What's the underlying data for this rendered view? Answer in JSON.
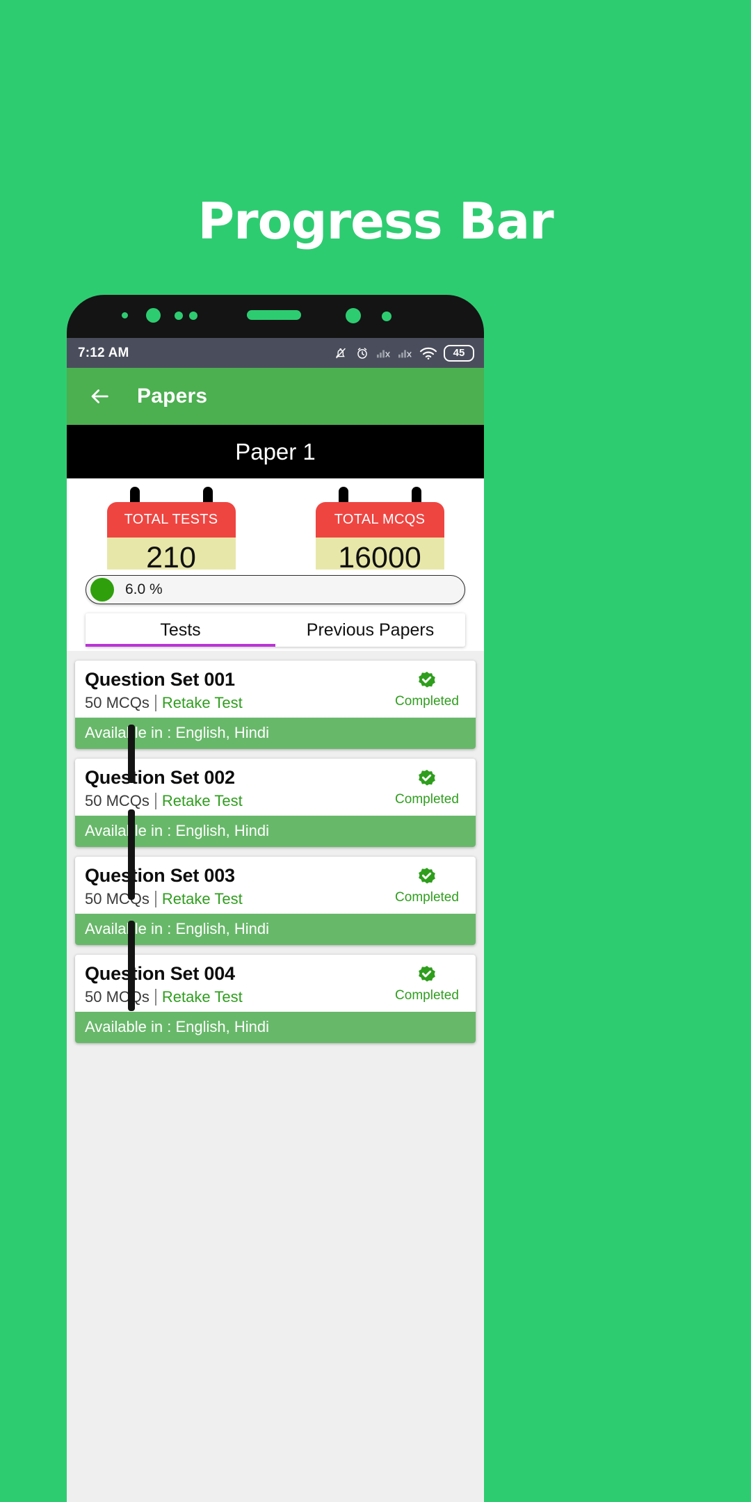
{
  "promo": {
    "title": "Progress Bar",
    "bg_color": "#2ECC71"
  },
  "statusbar": {
    "time": "7:12 AM",
    "battery": "45",
    "icons": [
      "bell-muted-icon",
      "alarm-icon",
      "signal-1-icon",
      "signal-2-icon",
      "wifi-icon",
      "battery-icon"
    ],
    "bg_color": "#4A4E5C"
  },
  "appbar": {
    "title": "Papers",
    "back_icon": "back-arrow-icon",
    "bg_color": "#4CAF50"
  },
  "banner": {
    "title": "Paper 1",
    "bg_color": "#000000"
  },
  "stats": [
    {
      "label": "TOTAL TESTS",
      "value": "210",
      "head_color": "#EF4541",
      "body_color": "#E7E7A9"
    },
    {
      "label": "TOTAL MCQS",
      "value": "16000",
      "head_color": "#EF4541",
      "body_color": "#E7E7A9"
    }
  ],
  "progress": {
    "text": "6.0 %",
    "percent": 6.0,
    "knob_color": "#2FA00C"
  },
  "tabs": [
    {
      "label": "Tests",
      "active": true
    },
    {
      "label": "Previous Papers",
      "active": false
    }
  ],
  "tab_indicator_color": "#BA33D6",
  "list": [
    {
      "title": "Question Set 001",
      "mcqs": "50 MCQs",
      "retake": "Retake Test",
      "status": "Completed",
      "available": "Available in : English, Hindi"
    },
    {
      "title": "Question Set 002",
      "mcqs": "50 MCQs",
      "retake": "Retake Test",
      "status": "Completed",
      "available": "Available in : English, Hindi"
    },
    {
      "title": "Question Set 003",
      "mcqs": "50 MCQs",
      "retake": "Retake Test",
      "status": "Completed",
      "available": "Available in : English, Hindi"
    },
    {
      "title": "Question Set 004",
      "mcqs": "50 MCQs",
      "retake": "Retake Test",
      "status": "Completed",
      "available": "Available in : English, Hindi"
    }
  ]
}
